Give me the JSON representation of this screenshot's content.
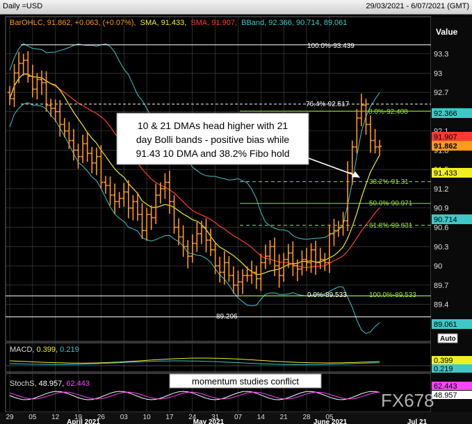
{
  "header": {
    "left": "Daily =USD",
    "right": "29/03/2021 - 6/07/2021 (GMT)"
  },
  "legend": {
    "ohlc": "BarOHLC, 91.862, +0.063, (+0.07%),",
    "sma1": "SMA, 91.433,",
    "sma2": "SMA, 91.907,",
    "bband": "BBand, 92.366, 90.714, 89.061"
  },
  "colors": {
    "bars": "#ff9a1a",
    "sma10": "#f0f020",
    "sma21": "#ff3b2f",
    "bband": "#3fc8c8",
    "fibo": "#9be82a",
    "grid": "#4a4a4a",
    "bg": "#000000"
  },
  "axis": {
    "value_label": "Value",
    "auto_label": "Auto",
    "y_ticks": [
      "93.3",
      "93",
      "92.7",
      "92.4",
      "92.1",
      "91.8",
      "91.5",
      "91.2",
      "90.9",
      "90.6",
      "90.3",
      "90",
      "89.7",
      "89.4"
    ],
    "x_ticks": [
      "29",
      "05",
      "12",
      "19",
      "26",
      "03",
      "10",
      "17",
      "24",
      "31",
      "07",
      "14",
      "21",
      "28",
      "05"
    ],
    "months": [
      "April 2021",
      "May 2021",
      "June 2021",
      "Jul 21"
    ]
  },
  "price_tags": {
    "bb_upper": "92.366",
    "sma21": "91.907",
    "last": "91.862",
    "sma10": "91.433",
    "bb_mid": "90.714",
    "bb_lower": "89.061"
  },
  "levels": {
    "hi100": "100.0%-93.439",
    "fib764": "76.4%-92.517",
    "fib0": "0.0%-92.408",
    "fib382": "38.2%-91.31",
    "fib50": "50.0%-90.971",
    "fib618": "61.8%-90.631",
    "low0": "0.0%-89.533",
    "fib100": "100.0%-89.533",
    "low": "89.206"
  },
  "annotation": {
    "line1": "10 & 21 DMAs head higher with 21",
    "line2": "day Bolli bands - positive bias while",
    "line3": "91.43 10 DMA and 38.2% Fibo hold"
  },
  "macd": {
    "label": "MACD, ",
    "v1": "0.399,",
    "v2": "0.219",
    "tag1": "0.399",
    "tag2": "0.219"
  },
  "stoch": {
    "label": "StochS, ",
    "v1": "48.957,",
    "v2": "62.443",
    "tag1": "62.443",
    "tag2": "48.957",
    "annotation": "momentum studies conflict"
  },
  "watermark": "FX678",
  "chart_data": {
    "type": "ohlc",
    "ylim": [
      89.1,
      93.6
    ],
    "x_start": "2021-03-29",
    "closes": [
      92.6,
      93.0,
      93.15,
      93.2,
      92.95,
      92.75,
      92.9,
      92.85,
      92.5,
      92.45,
      92.4,
      92.2,
      92.1,
      91.95,
      91.8,
      91.7,
      91.9,
      91.75,
      91.6,
      91.7,
      91.3,
      91.25,
      91.1,
      91.0,
      91.05,
      91.15,
      90.9,
      91.0,
      90.8,
      90.55,
      90.8,
      90.75,
      91.1,
      91.2,
      91.3,
      91.0,
      90.6,
      90.45,
      90.3,
      90.15,
      90.35,
      90.5,
      90.6,
      90.4,
      90.25,
      90.0,
      89.9,
      90.05,
      89.85,
      89.7,
      89.75,
      89.85,
      89.85,
      89.9,
      89.8,
      90.05,
      90.15,
      90.3,
      90.0,
      89.85,
      90.1,
      90.2,
      90.0,
      89.95,
      90.1,
      90.05,
      90.25,
      90.05,
      90.1,
      90.05,
      90.5,
      90.55,
      90.6,
      90.7,
      91.45,
      91.85,
      92.3,
      92.5,
      92.2,
      91.95,
      91.85,
      91.86
    ],
    "sma10_last": 91.433,
    "sma21_last": 91.907,
    "bband": {
      "upper": 92.366,
      "middle": 90.714,
      "lower": 89.061
    },
    "macd": {
      "macd": 0.399,
      "signal": 0.219
    },
    "stoch": {
      "k": 48.957,
      "d": 62.443
    }
  }
}
